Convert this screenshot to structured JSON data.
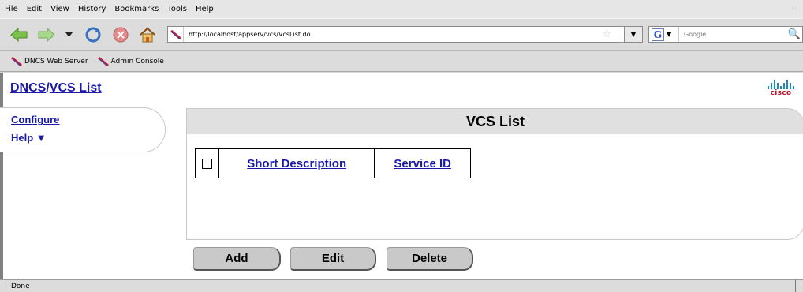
{
  "menubar": {
    "items": [
      "File",
      "Edit",
      "View",
      "History",
      "Bookmarks",
      "Tools",
      "Help"
    ]
  },
  "navbar": {
    "url": "http://localhost/appserv/vcs/VcsList.do",
    "search_placeholder": "Google",
    "search_engine_icon": "google-g-icon"
  },
  "bookmarks": [
    {
      "label": "DNCS Web Server",
      "icon": "feather-icon"
    },
    {
      "label": "Admin Console",
      "icon": "feather-icon"
    }
  ],
  "page": {
    "breadcrumb": {
      "part1": "DNCS",
      "separator": "/",
      "part2": "VCS List"
    },
    "logo_text": "cisco",
    "side_nav": {
      "configure": "Configure",
      "help": "Help ▼"
    },
    "main_title": "VCS List",
    "table": {
      "columns": [
        "Short Description",
        "Service ID"
      ]
    },
    "buttons": {
      "add": "Add",
      "edit": "Edit",
      "delete": "Delete"
    }
  },
  "status": {
    "text": "Done"
  },
  "colors": {
    "link": "#1a1aaa",
    "cisco_blue": "#1b89c6",
    "cisco_red": "#c3122f",
    "panel_bar": "#e0e0e0"
  }
}
